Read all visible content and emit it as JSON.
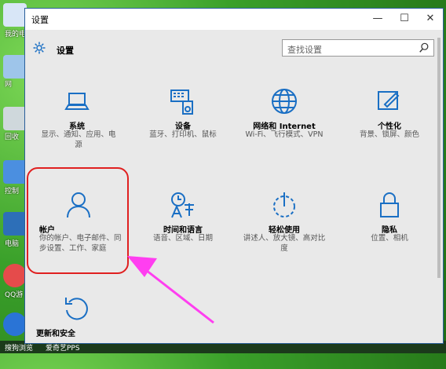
{
  "desktop": {
    "icons": [
      {
        "label": "我的电"
      },
      {
        "label": "网"
      },
      {
        "label": "回收"
      },
      {
        "label": "控制"
      },
      {
        "label": "电脑"
      },
      {
        "label": "QQ游"
      },
      {
        "label": ""
      }
    ]
  },
  "taskbar": {
    "items": [
      {
        "label": "搜狗浏览"
      },
      {
        "label": "爱奇艺PPS"
      }
    ]
  },
  "window": {
    "title": "设置",
    "minimize": "—",
    "maximize": "☐",
    "close": "✕",
    "page_title": "设置",
    "search_placeholder": "查找设置"
  },
  "tiles": [
    {
      "name": "系统",
      "desc": "显示、通知、应用、电源"
    },
    {
      "name": "设备",
      "desc": "蓝牙、打印机、鼠标"
    },
    {
      "name": "网络和 Internet",
      "desc": "Wi-Fi、飞行模式、VPN"
    },
    {
      "name": "个性化",
      "desc": "背景、锁屏、颜色"
    },
    {
      "name": "帐户",
      "desc": "你的帐户、电子邮件、同步设置、工作、家庭"
    },
    {
      "name": "时间和语言",
      "desc": "语音、区域、日期"
    },
    {
      "name": "轻松使用",
      "desc": "讲述人、放大镜、高对比度"
    },
    {
      "name": "隐私",
      "desc": "位置、相机"
    },
    {
      "name": "更新和安全",
      "desc": ""
    }
  ],
  "colors": {
    "accent": "#1a6fc4",
    "highlight": "#e02020",
    "arrow": "#ff3ef0"
  }
}
